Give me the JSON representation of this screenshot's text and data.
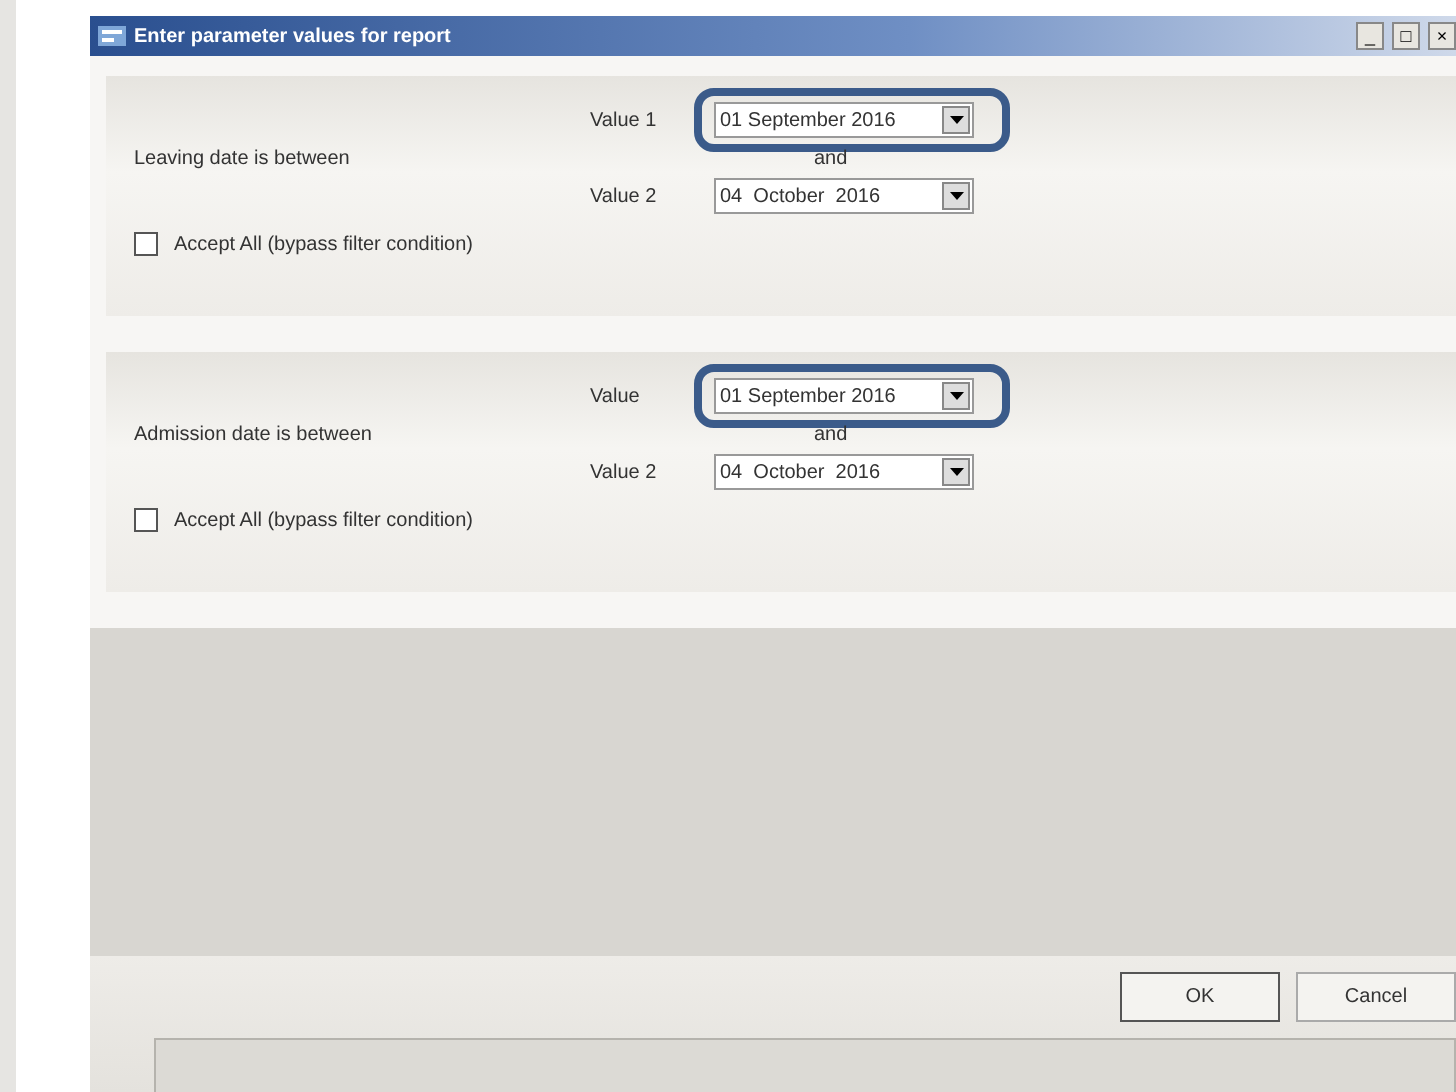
{
  "window": {
    "title": "Enter parameter values for report",
    "controls": [
      "_",
      "□",
      "×"
    ]
  },
  "filters": [
    {
      "label": "Leaving date is between",
      "value1_label": "Value 1",
      "value1": "01 September 2016",
      "value1_highlighted": true,
      "and_label": "and",
      "value2_label": "Value 2",
      "value2": "04  October  2016",
      "accept_all": {
        "label": "Accept All (bypass filter condition)",
        "checked": false
      }
    },
    {
      "label": "Admission date is between",
      "value1_label": "Value",
      "value1": "01 September 2016",
      "value1_highlighted": true,
      "and_label": "and",
      "value2_label": "Value 2",
      "value2": "04  October  2016",
      "accept_all": {
        "label": "Accept All (bypass filter condition)",
        "checked": false
      }
    }
  ],
  "buttons": [
    "OK",
    "Cancel"
  ]
}
